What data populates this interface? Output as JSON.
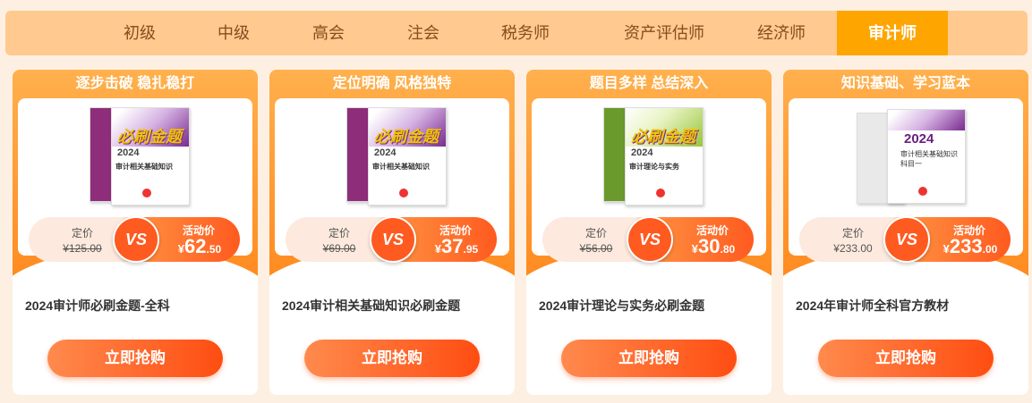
{
  "tabs": [
    {
      "label": "初级",
      "active": false
    },
    {
      "label": "中级",
      "active": false
    },
    {
      "label": "高会",
      "active": false
    },
    {
      "label": "注会",
      "active": false
    },
    {
      "label": "税务师",
      "active": false
    },
    {
      "label": "资产评估师",
      "active": false
    },
    {
      "label": "经济师",
      "active": false
    },
    {
      "label": "审计师",
      "active": true
    }
  ],
  "colors": {
    "tab_bar": "#ffc98f",
    "tab_active": "#ffa500",
    "accent": "#ff5a1f",
    "page_bg": "#fdf0e2"
  },
  "products": [
    {
      "slogan": "逐步击破 稳扎稳打",
      "cover": {
        "brush": "必刷金题",
        "year": "2024",
        "subject": "审计相关基础知识"
      },
      "orig_label": "定价",
      "orig_price": "¥125.00",
      "strike": true,
      "vs": "VS",
      "act_label": "活动价",
      "currency": "¥",
      "act_int": "62",
      "act_dec": ".50",
      "name": "2024审计师必刷金题-全科",
      "button": "立即抢购"
    },
    {
      "slogan": "定位明确 风格独特",
      "cover": {
        "brush": "必刷金题",
        "year": "2024",
        "subject": "审计相关基础知识"
      },
      "orig_label": "定价",
      "orig_price": "¥69.00",
      "strike": true,
      "vs": "VS",
      "act_label": "活动价",
      "currency": "¥",
      "act_int": "37",
      "act_dec": ".95",
      "name": "2024审计相关基础知识必刷金题",
      "button": "立即抢购"
    },
    {
      "slogan": "题目多样 总结深入",
      "cover": {
        "brush": "必刷金题",
        "year": "2024",
        "subject": "审计理论与实务"
      },
      "orig_label": "定价",
      "orig_price": "¥56.00",
      "strike": true,
      "vs": "VS",
      "act_label": "活动价",
      "currency": "¥",
      "act_int": "30",
      "act_dec": ".80",
      "name": "2024审计理论与实务必刷金题",
      "button": "立即抢购"
    },
    {
      "slogan": "知识基础、学习蓝本",
      "cover": {
        "brush": "",
        "year": "2024",
        "subject": "审计相关基础知识",
        "sub": "科目一"
      },
      "orig_label": "定价",
      "orig_price": "¥233.00",
      "strike": false,
      "vs": "VS",
      "act_label": "活动价",
      "currency": "¥",
      "act_int": "233",
      "act_dec": ".00",
      "name": "2024年审计师全科官方教材",
      "button": "立即抢购"
    }
  ]
}
